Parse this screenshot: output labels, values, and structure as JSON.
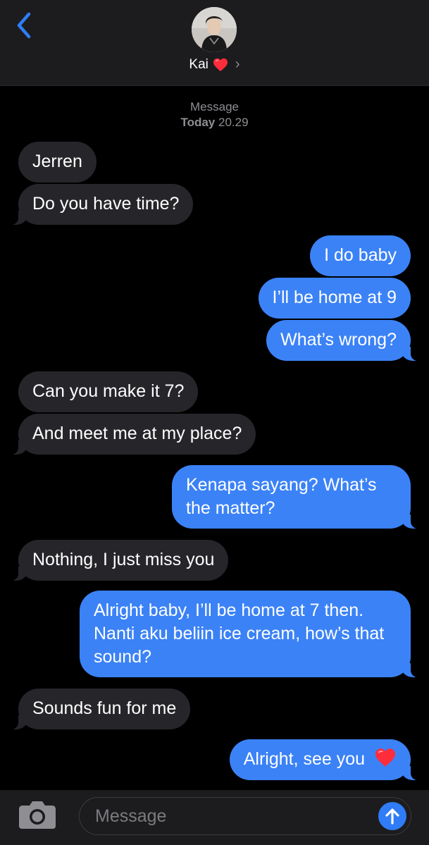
{
  "header": {
    "contact_name": "Kai",
    "back_icon": "chevron-left-icon",
    "heart_icon": "red-heart-icon",
    "chevron": "›"
  },
  "thread": {
    "meta_label": "Message",
    "meta_day": "Today",
    "meta_time": "20.29"
  },
  "messages": [
    {
      "from": "them",
      "text": "Jerren"
    },
    {
      "from": "them",
      "text": "Do you have time?"
    },
    {
      "from": "me",
      "text": "I do baby"
    },
    {
      "from": "me",
      "text": "I’ll be home at 9"
    },
    {
      "from": "me",
      "text": "What’s wrong?"
    },
    {
      "from": "them",
      "text": "Can you make it 7?"
    },
    {
      "from": "them",
      "text": "And meet me at my place?"
    },
    {
      "from": "me",
      "text": "Kenapa sayang? What’s the matter?"
    },
    {
      "from": "them",
      "text": "Nothing, I just miss you"
    },
    {
      "from": "me",
      "text": "Alright baby, I’ll be home at 7 then. Nanti aku beliin ice cream, how’s that sound?"
    },
    {
      "from": "them",
      "text": "Sounds fun for me"
    },
    {
      "from": "me",
      "text": "Alright, see you"
    }
  ],
  "composer": {
    "placeholder": "Message",
    "camera_icon": "camera-icon",
    "send_icon": "arrow-up-icon"
  },
  "colors": {
    "background": "#000000",
    "header_bg": "#1c1c1e",
    "incoming_bubble": "#26262a",
    "outgoing_bubble": "#3b82f6",
    "accent": "#2f7cf6",
    "heart": "#ff2d3b"
  }
}
